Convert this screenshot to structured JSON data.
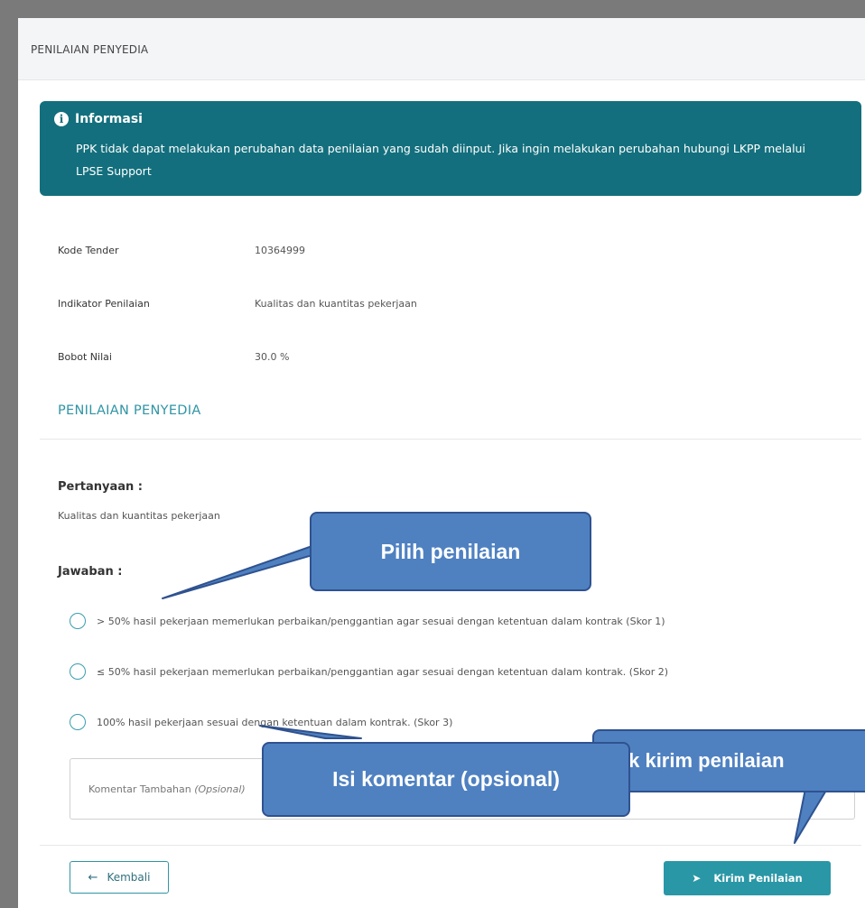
{
  "header": {
    "title": "PENILAIAN PENYEDIA"
  },
  "info": {
    "title": "Informasi",
    "icon": "info-icon",
    "text": "PPK tidak dapat melakukan perubahan data penilaian yang sudah diinput. Jika ingin melakukan perubahan hubungi LKPP melalui LPSE Support"
  },
  "meta": [
    {
      "label": "Kode Tender",
      "value": "10364999"
    },
    {
      "label": "Indikator Penilaian",
      "value": "Kualitas dan kuantitas pekerjaan"
    },
    {
      "label": "Bobot Nilai",
      "value": "30.0 %"
    }
  ],
  "section": {
    "title": "PENILAIAN PENYEDIA"
  },
  "question": {
    "label": "Pertanyaan :",
    "text": "Kualitas dan kuantitas pekerjaan"
  },
  "answer": {
    "label": "Jawaban :",
    "options": [
      "> 50% hasil pekerjaan memerlukan perbaikan/penggantian agar sesuai dengan ketentuan dalam kontrak (Skor 1)",
      "≤ 50% hasil pekerjaan memerlukan perbaikan/penggantian agar sesuai dengan ketentuan dalam kontrak. (Skor 2)",
      "100% hasil pekerjaan sesuai dengan ketentuan dalam kontrak. (Skor 3)"
    ]
  },
  "comment": {
    "placeholder_main": "Komentar Tambahan ",
    "placeholder_optional": "(Opsional)"
  },
  "buttons": {
    "back_label": "Kembali",
    "send_label": "Kirim Penilaian"
  },
  "callouts": {
    "pilih": "Pilih penilaian",
    "kirim": "Klik kirim penilaian",
    "isi": "Isi komentar (opsional)"
  },
  "colors": {
    "info_bg": "#136f7d",
    "accent": "#2a97a6",
    "callout": "#4f81c1"
  }
}
